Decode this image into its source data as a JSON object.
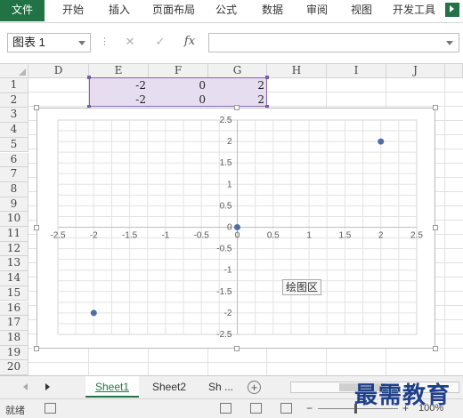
{
  "ribbon": {
    "tabs": [
      "文件",
      "开始",
      "插入",
      "页面布局",
      "公式",
      "数据",
      "审阅",
      "视图",
      "开发工具"
    ]
  },
  "formula_bar": {
    "name_box": "图表 1",
    "cancel_glyph": "✕",
    "enter_glyph": "✓",
    "fx_glyph": "fx",
    "separator": "⋮"
  },
  "sheet": {
    "columns": [
      "D",
      "E",
      "F",
      "G",
      "H",
      "I",
      "J"
    ],
    "rows": [
      "1",
      "2",
      "3",
      "4",
      "5",
      "6",
      "7",
      "8",
      "9",
      "10",
      "11",
      "12",
      "13",
      "14",
      "15",
      "16",
      "17",
      "18",
      "19",
      "20"
    ],
    "cells": {
      "E1": "-2",
      "F1": "0",
      "G1": "2",
      "E2": "-2",
      "F2": "0",
      "G2": "2"
    }
  },
  "chart_data": {
    "type": "scatter",
    "x_ticks": [
      "-2.5",
      "-2",
      "-1.5",
      "-1",
      "-0.5",
      "0",
      "0.5",
      "1",
      "1.5",
      "2",
      "2.5"
    ],
    "y_ticks": [
      "2.5",
      "2",
      "1.5",
      "1",
      "0.5",
      "0",
      "-0.5",
      "-1",
      "-1.5",
      "-2",
      "-2.5"
    ],
    "xlim": [
      -2.5,
      2.5
    ],
    "ylim": [
      -2.5,
      2.5
    ],
    "grid": true,
    "series": [
      {
        "x": [
          -2,
          0,
          2
        ],
        "y": [
          -2,
          0,
          2
        ],
        "color": "#4f6fa3"
      }
    ],
    "plot_area_label": "绘图区"
  },
  "sheet_tabs": {
    "tabs": [
      "Sheet1",
      "Sheet2",
      "Sh ..."
    ],
    "active": "Sheet1",
    "add_glyph": "+"
  },
  "status_bar": {
    "ready": "就绪",
    "zoom_minus": "−",
    "zoom_plus": "+",
    "zoom": "100%"
  },
  "watermark": "最需教育",
  "colors": {
    "accent": "#217346",
    "selection": "#7a5bab",
    "marker": "#4f6fa3"
  }
}
